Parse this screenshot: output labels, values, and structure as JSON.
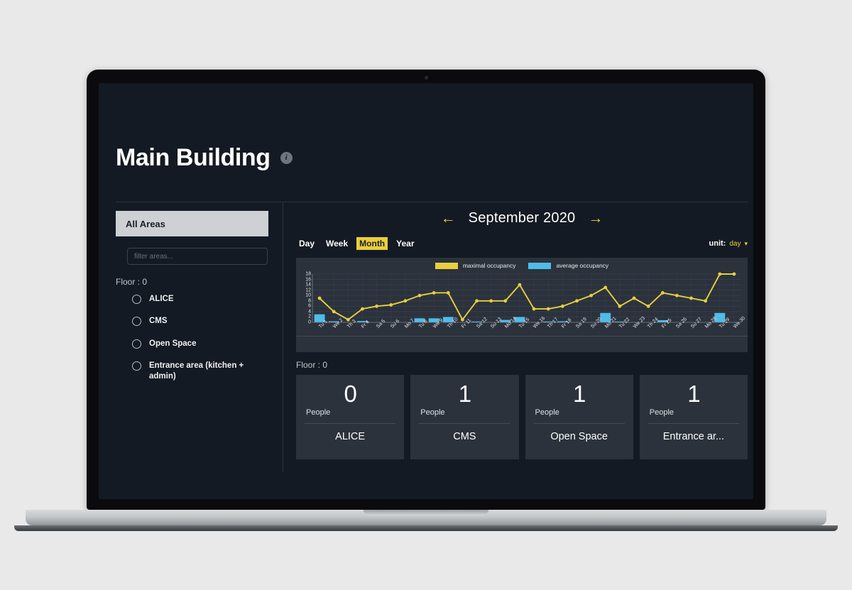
{
  "header": {
    "title": "Main Building",
    "info_icon": "info-icon",
    "info_glyph": "i"
  },
  "sidebar": {
    "all_areas_label": "All Areas",
    "filter_placeholder": "filter areas...",
    "filter_value": "",
    "floor_label": "Floor : 0",
    "areas": [
      {
        "label": "ALICE",
        "selected": false
      },
      {
        "label": "CMS",
        "selected": false
      },
      {
        "label": "Open Space",
        "selected": false
      },
      {
        "label": "Entrance area (kitchen + admin)",
        "selected": false
      }
    ]
  },
  "main": {
    "date_nav": {
      "prev_arrow": "←",
      "label": "September 2020",
      "next_arrow": "→"
    },
    "range_tabs": [
      {
        "label": "Day",
        "active": false
      },
      {
        "label": "Week",
        "active": false
      },
      {
        "label": "Month",
        "active": true
      },
      {
        "label": "Year",
        "active": false
      }
    ],
    "unit_selector": {
      "key": "unit:",
      "value": "day",
      "caret": "▾"
    },
    "floor_label": "Floor : 0",
    "cards": [
      {
        "count": "0",
        "unit": "People",
        "name": "ALICE"
      },
      {
        "count": "1",
        "unit": "People",
        "name": "CMS"
      },
      {
        "count": "1",
        "unit": "People",
        "name": "Open Space"
      },
      {
        "count": "1",
        "unit": "People",
        "name": "Entrance ar..."
      }
    ]
  },
  "colors": {
    "accent_yellow": "#e9cf3e",
    "accent_blue": "#4fbce8",
    "app_background": "#141a23",
    "panel_background": "#2b323c",
    "selected_pill": "#cdd0d4"
  },
  "chart_data": {
    "type": "line",
    "title": "",
    "xlabel": "",
    "ylabel": "",
    "ylim": [
      0,
      18
    ],
    "yticks": [
      0,
      2,
      4,
      6,
      8,
      10,
      12,
      14,
      16,
      18
    ],
    "grid": true,
    "legend_position": "top-center",
    "categories": [
      "Tu 1",
      "We 2",
      "Th 3",
      "Fr 4",
      "Sa 5",
      "Su 6",
      "Mo 7",
      "Tu 8",
      "We 9",
      "Th 10",
      "Fr 11",
      "Sa 12",
      "Su 13",
      "Mo 14",
      "Tu 15",
      "We 16",
      "Th 17",
      "Fr 18",
      "Sa 19",
      "Su 20",
      "Mo 21",
      "Tu 22",
      "We 23",
      "Th 24",
      "Fr 25",
      "Sa 26",
      "Su 27",
      "Mo 28",
      "Tu 29",
      "We 30"
    ],
    "series": [
      {
        "name": "maximal occupancy",
        "type": "line",
        "color": "#e9cf3e",
        "values": [
          9,
          4,
          1,
          5,
          6,
          6.5,
          8,
          10,
          11,
          11,
          1,
          8,
          8,
          8,
          14,
          5,
          5,
          6,
          8,
          10,
          13,
          6,
          9,
          6,
          11,
          10,
          9,
          8,
          18,
          18
        ]
      },
      {
        "name": "average occupancy",
        "type": "bar",
        "color": "#4fbce8",
        "values": [
          3,
          0.4,
          0,
          0.5,
          0,
          0,
          0,
          1.5,
          1.5,
          2,
          0,
          0.2,
          0,
          0.9,
          2,
          0,
          0.2,
          0.4,
          0,
          0,
          3.5,
          0.2,
          0,
          0,
          0.8,
          0,
          0,
          0,
          3.5,
          0
        ]
      }
    ]
  }
}
